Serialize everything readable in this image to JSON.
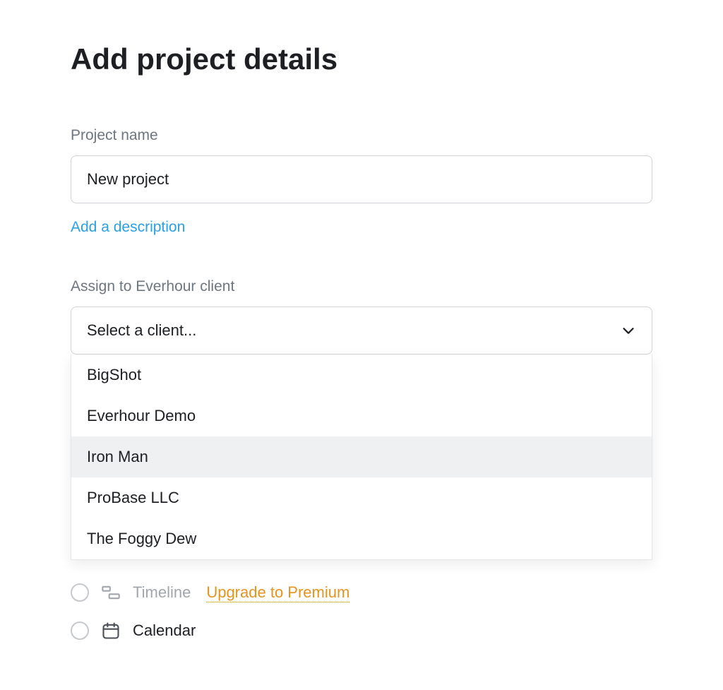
{
  "title": "Add project details",
  "project_name": {
    "label": "Project name",
    "value": "New project"
  },
  "add_description_label": "Add a description",
  "client_select": {
    "label": "Assign to Everhour client",
    "placeholder": "Select a client...",
    "options": [
      "BigShot",
      "Everhour Demo",
      "Iron Man",
      "ProBase LLC",
      "The Foggy Dew"
    ],
    "highlighted_index": 2
  },
  "view_options": {
    "timeline": {
      "label": "Timeline",
      "upgrade_label": "Upgrade to Premium"
    },
    "calendar": {
      "label": "Calendar"
    }
  }
}
